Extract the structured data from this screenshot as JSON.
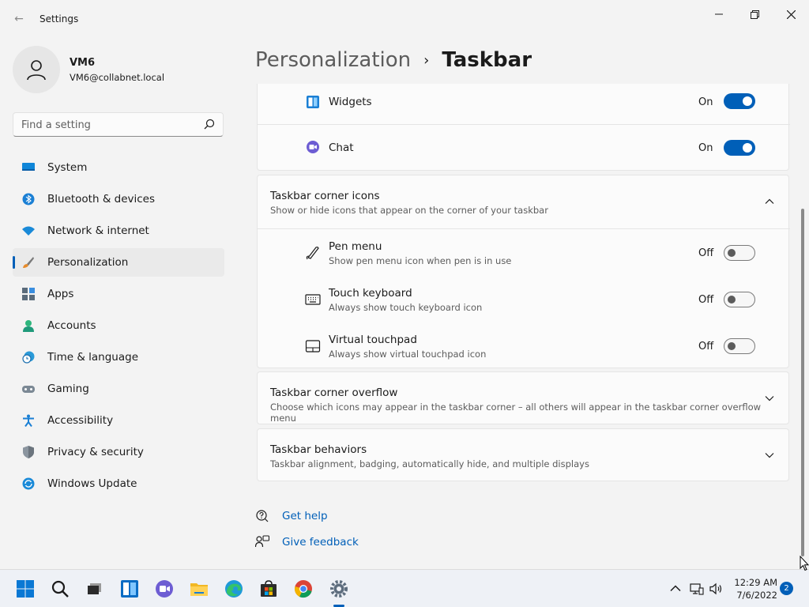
{
  "window": {
    "title": "Settings",
    "back_glyph": "←"
  },
  "profile": {
    "name": "VM6",
    "email": "VM6@collabnet.local"
  },
  "search": {
    "placeholder": "Find a setting"
  },
  "sidebar": {
    "items": [
      {
        "label": "System",
        "icon": "system-icon"
      },
      {
        "label": "Bluetooth & devices",
        "icon": "bluetooth-icon"
      },
      {
        "label": "Network & internet",
        "icon": "wifi-icon"
      },
      {
        "label": "Personalization",
        "icon": "brush-icon",
        "active": true
      },
      {
        "label": "Apps",
        "icon": "apps-icon"
      },
      {
        "label": "Accounts",
        "icon": "accounts-icon"
      },
      {
        "label": "Time & language",
        "icon": "clock-globe-icon"
      },
      {
        "label": "Gaming",
        "icon": "gamepad-icon"
      },
      {
        "label": "Accessibility",
        "icon": "accessibility-icon"
      },
      {
        "label": "Privacy & security",
        "icon": "shield-icon"
      },
      {
        "label": "Windows Update",
        "icon": "update-icon"
      }
    ]
  },
  "breadcrumb": {
    "parent": "Personalization",
    "separator": "›",
    "current": "Taskbar"
  },
  "taskbar_items": {
    "widgets": {
      "label": "Widgets",
      "state": "On",
      "on": true
    },
    "chat": {
      "label": "Chat",
      "state": "On",
      "on": true
    }
  },
  "corner_icons": {
    "title": "Taskbar corner icons",
    "subtitle": "Show or hide icons that appear on the corner of your taskbar",
    "items": [
      {
        "title": "Pen menu",
        "subtitle": "Show pen menu icon when pen is in use",
        "state": "Off",
        "on": false
      },
      {
        "title": "Touch keyboard",
        "subtitle": "Always show touch keyboard icon",
        "state": "Off",
        "on": false
      },
      {
        "title": "Virtual touchpad",
        "subtitle": "Always show virtual touchpad icon",
        "state": "Off",
        "on": false
      }
    ]
  },
  "corner_overflow": {
    "title": "Taskbar corner overflow",
    "subtitle": "Choose which icons may appear in the taskbar corner – all others will appear in the taskbar corner overflow menu"
  },
  "behaviors": {
    "title": "Taskbar behaviors",
    "subtitle": "Taskbar alignment, badging, automatically hide, and multiple displays"
  },
  "help": {
    "get_help": "Get help",
    "give_feedback": "Give feedback"
  },
  "system_tray": {
    "time": "12:29 AM",
    "date": "7/6/2022",
    "notifications": "2"
  },
  "colors": {
    "accent": "#005fb8",
    "background": "#f3f3f3",
    "card": "#fbfbfb"
  }
}
